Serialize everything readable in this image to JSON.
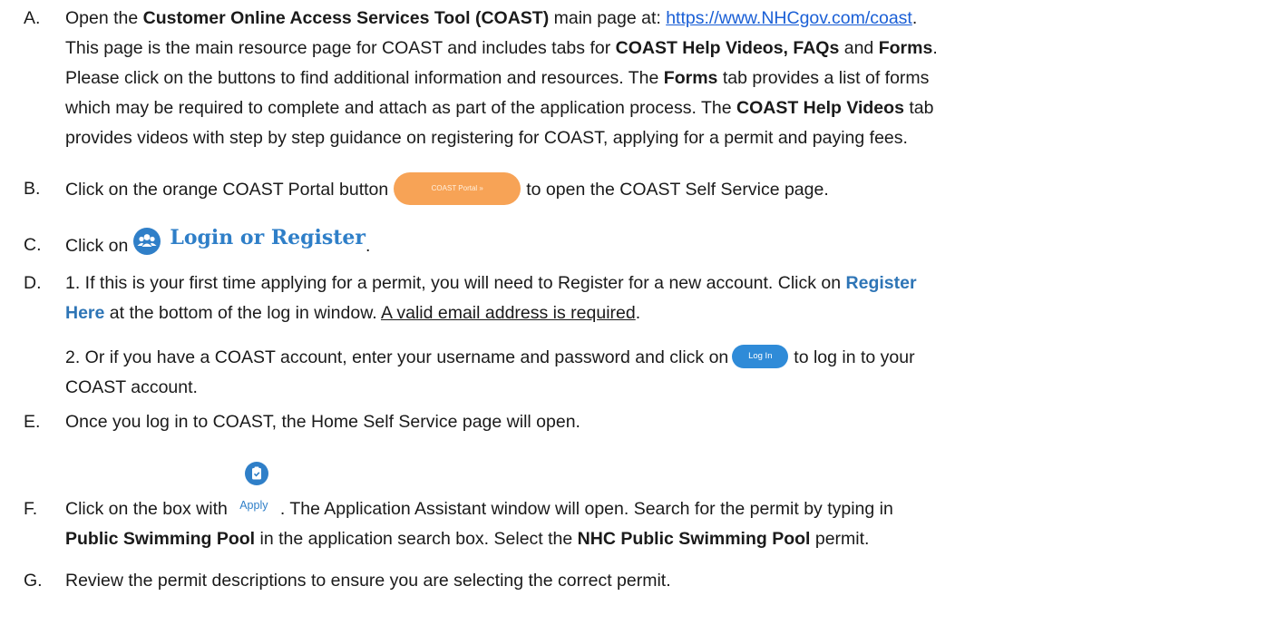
{
  "steps": {
    "a": {
      "marker": "A.",
      "l1_t1": "Open the ",
      "l1_b1": "Customer Online Access Services Tool (COAST)",
      "l1_t2": " main page at: ",
      "l1_link": "https://www.NHCgov.com/coast",
      "l1_t3": ".",
      "l2_t1": "This page is the main resource page for COAST and includes tabs for ",
      "l2_b1": "COAST Help Videos, FAQs",
      "l2_t2": " and ",
      "l2_b2": "Forms",
      "l2_t3": ".",
      "l3_t1": "Please click on the buttons to find additional information and resources.  The ",
      "l3_b1": "Forms",
      "l3_t2": " tab provides a list of forms",
      "l4_t1": "which may be required to complete and attach as part of the application process.  The ",
      "l4_b1": "COAST Help Videos",
      "l4_t2": " tab",
      "l5_t1": "provides videos with step by step guidance on registering for COAST, applying for a permit and paying fees."
    },
    "b": {
      "marker": "B.",
      "t1": "Click on the orange COAST Portal button",
      "btn": "COAST Portal »",
      "t2": "to open the COAST Self Service page."
    },
    "c": {
      "marker": "C.",
      "t1": "Click on",
      "btn": "Login or Register",
      "t2": "."
    },
    "d": {
      "marker": "D.",
      "l1_t1": "1. If this is your first time applying for a permit, you will need to Register for a new account. Click on ",
      "l1_b1": "Register",
      "l2_b1": "Here",
      "l2_t1": " at the bottom of the log in window. ",
      "l2_u1": "A valid email address is required",
      "l2_t2": ".",
      "l3_t1": "2. Or if you have a COAST account, enter your username and password and click on",
      "l3_btn": "Log In",
      "l3_t2": "to log in to your",
      "l4_t1": "COAST account."
    },
    "e": {
      "marker": "E.",
      "t1": "Once you log in to COAST, the Home Self Service page will open."
    },
    "f": {
      "marker": "F.",
      "l1_t1": "Click on the box with",
      "l1_btn": "Apply",
      "l1_t2": ". The Application Assistant window will open.  Search for the permit by typing in",
      "l2_b1": "Public Swimming Pool",
      "l2_t1": " in the application search box. Select the ",
      "l2_b2": "NHC Public Swimming Pool",
      "l2_t2": " permit."
    },
    "g": {
      "marker": "G.",
      "t1": "Review the permit descriptions to ensure you are selecting the correct permit."
    }
  },
  "icons": {
    "coast_button_color": "#f7a356",
    "login_icon": "users-icon",
    "login_color": "#2f7fc8",
    "apply_icon": "clipboard-check-icon",
    "link_color": "#1a5fd6"
  }
}
